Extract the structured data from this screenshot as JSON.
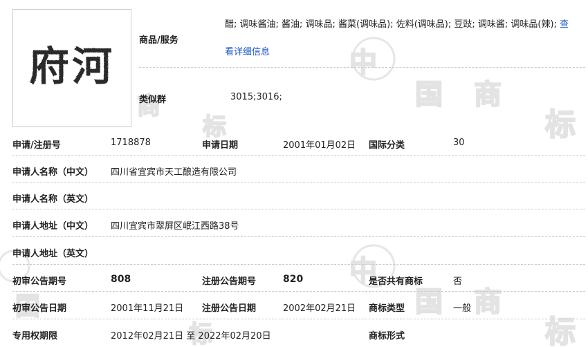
{
  "logo": {
    "text": "府河"
  },
  "goods": {
    "label": "商品/服务",
    "text": "醋; 调味酱油; 酱油; 调味品; 酱菜(调味品); 佐料(调味品); 豆豉; 调味酱; 调味品(辣); ",
    "more_label": "查",
    "detail_link": "看详细信息"
  },
  "similar_group": {
    "label": "类似群",
    "value": "3015;3016;"
  },
  "rows": [
    {
      "label1": "申请/注册号",
      "value1": "1718878",
      "label2": "申请日期",
      "value2": "2001年01月02日",
      "label3": "国际分类",
      "value3": "30"
    },
    {
      "label1": "申请人名称（中文）",
      "value1": "四川省宜宾市天工酿造有限公司"
    },
    {
      "label1": "申请人名称（英文）",
      "value1": ""
    },
    {
      "label1": "申请人地址（中文）",
      "value1": "四川宜宾市翠屏区岷江西路38号"
    },
    {
      "label1": "申请人地址（英文）",
      "value1": ""
    },
    {
      "label1": "初审公告期号",
      "value1": "808",
      "label2": "注册公告期号",
      "value2": "820",
      "label3": "是否共有商标",
      "value3": "否"
    },
    {
      "label1": "初审公告日期",
      "value1": "2001年11月21日",
      "label2": "注册公告日期",
      "value2": "2002年02月21日",
      "label3": "商标类型",
      "value3": "一般"
    },
    {
      "label1": "专用权期限",
      "value1": "2012年02月21日 至 2022年02月20日",
      "label3": "商标形式",
      "value3": ""
    }
  ],
  "watermark": {
    "chars": [
      "中",
      "国",
      "商",
      "标"
    ],
    "color": "#e3e3e3"
  }
}
